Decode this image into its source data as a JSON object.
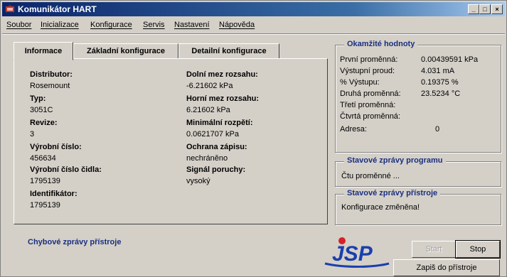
{
  "window": {
    "title": "Komunikátor HART",
    "min_label": "_",
    "max_label": "□",
    "close_label": "×"
  },
  "menu": [
    "Soubor",
    "Inicializace",
    "Konfigurace",
    "Servis",
    "Nastavení",
    "Nápověda"
  ],
  "tabs": [
    "Informace",
    "Základní konfigurace",
    "Detailní konfigurace"
  ],
  "info": {
    "distributor_label": "Distributor:",
    "distributor_value": "Rosemount",
    "typ_label": "Typ:",
    "typ_value": "3051C",
    "revize_label": "Revize:",
    "revize_value": "3",
    "vyrobni_label": "Výrobní číslo:",
    "vyrobni_value": "456634",
    "vyrobni_cidla_label": "Výrobní číslo čidla:",
    "vyrobni_cidla_value": "1795139",
    "identifikator_label": "Identifikátor:",
    "identifikator_value": "1795139",
    "dolni_label": "Dolní mez rozsahu:",
    "dolni_value": "-6.21602 kPa",
    "horni_label": "Horní mez rozsahu:",
    "horni_value": "6.21602 kPa",
    "min_rozpeti_label": "Minimální rozpětí:",
    "min_rozpeti_value": "0.0621707 kPa",
    "ochrana_label": "Ochrana zápisu:",
    "ochrana_value": "nechráněno",
    "signal_label": "Signál poruchy:",
    "signal_value": "vysoký"
  },
  "okamzite": {
    "title": "Okamžité hodnoty",
    "rows": [
      {
        "label": "První proměnná:",
        "value": "0.00439591 kPa"
      },
      {
        "label": "Výstupní proud:",
        "value": "4.031 mA"
      },
      {
        "label": "% Výstupu:",
        "value": "0.19375 %"
      },
      {
        "label": "Druhá proměnná:",
        "value": "23.5234 °C"
      },
      {
        "label": "Třetí proměnná:",
        "value": ""
      },
      {
        "label": "Čtvrtá proměnná:",
        "value": ""
      },
      {
        "label": "Adresa:",
        "value": "0"
      }
    ]
  },
  "program": {
    "title": "Stavové zprávy programu",
    "text": "Čtu proměnné ..."
  },
  "pristroj": {
    "title": "Stavové zprávy přístroje",
    "text": "Konfigurace změněna!"
  },
  "chybove": "Chybové zprávy přístroje",
  "logo": {
    "text": "JSP",
    "colors": {
      "red": "#d62128",
      "blue": "#1a3fae"
    }
  },
  "buttons": {
    "start": "Start",
    "stop": "Stop",
    "write": "Zapiš do přístroje"
  }
}
